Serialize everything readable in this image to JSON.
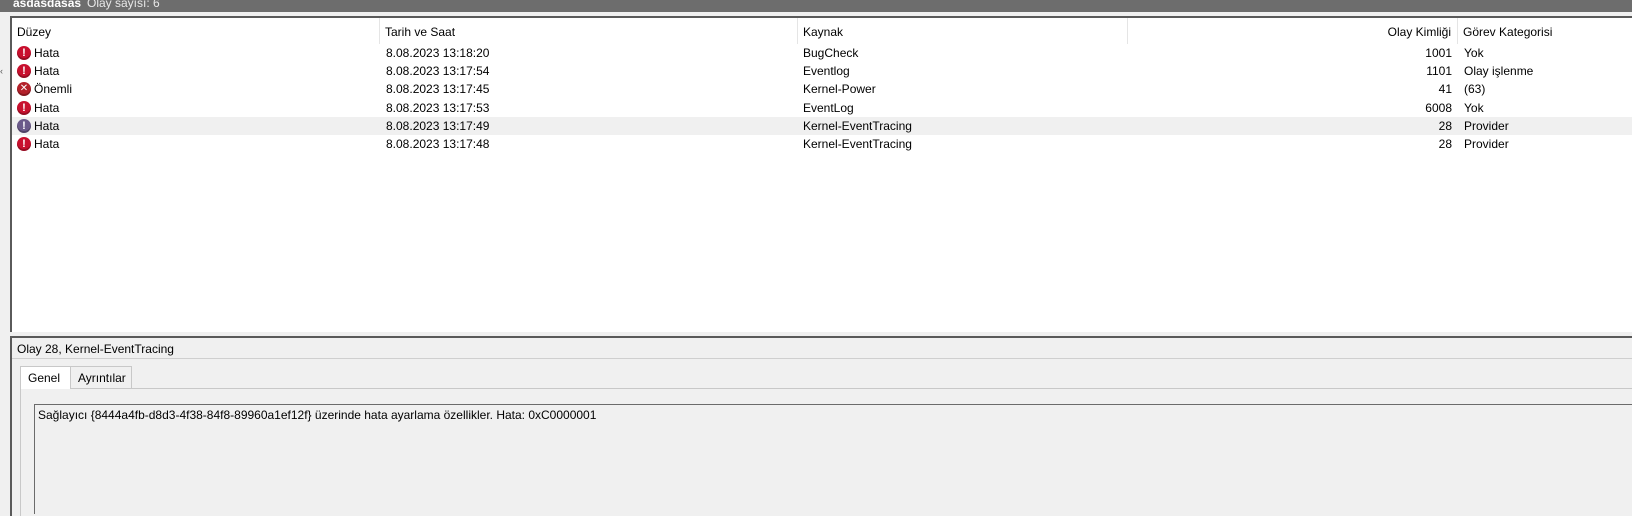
{
  "window": {
    "log_name": "asdasdasas",
    "event_count_label": "Olay sayısı: 6"
  },
  "columns": [
    {
      "label": "Düzey"
    },
    {
      "label": "Tarih ve Saat"
    },
    {
      "label": "Kaynak"
    },
    {
      "label": ""
    },
    {
      "label": "Olay Kimliği"
    },
    {
      "label": "Görev Kategorisi"
    }
  ],
  "rows": [
    {
      "level": "Hata",
      "icon": "error-icon",
      "datetime": "8.08.2023 13:18:20",
      "source": "BugCheck",
      "event_id": "1001",
      "category": "Yok"
    },
    {
      "level": "Hata",
      "icon": "error-icon",
      "datetime": "8.08.2023 13:17:54",
      "source": "Eventlog",
      "event_id": "1101",
      "category": "Olay işlenme"
    },
    {
      "level": "Önemli",
      "icon": "critical-icon",
      "datetime": "8.08.2023 13:17:45",
      "source": "Kernel-Power",
      "event_id": "41",
      "category": "(63)"
    },
    {
      "level": "Hata",
      "icon": "error-icon",
      "datetime": "8.08.2023 13:17:53",
      "source": "EventLog",
      "event_id": "6008",
      "category": "Yok"
    },
    {
      "level": "Hata",
      "icon": "error-icon",
      "datetime": "8.08.2023 13:17:49",
      "source": "Kernel-EventTracing",
      "event_id": "28",
      "category": "Provider",
      "selected": true
    },
    {
      "level": "Hata",
      "icon": "error-icon",
      "datetime": "8.08.2023 13:17:48",
      "source": "Kernel-EventTracing",
      "event_id": "28",
      "category": "Provider"
    }
  ],
  "detail": {
    "title": "Olay 28, Kernel-EventTracing",
    "tabs": [
      {
        "label": "Genel",
        "active": true
      },
      {
        "label": "Ayrıntılar",
        "active": false
      }
    ],
    "message": "Sağlayıcı {8444a4fb-d8d3-4f38-84f8-89960a1ef12f} üzerinde hata ayarlama özellikler. Hata: 0xC0000001"
  }
}
